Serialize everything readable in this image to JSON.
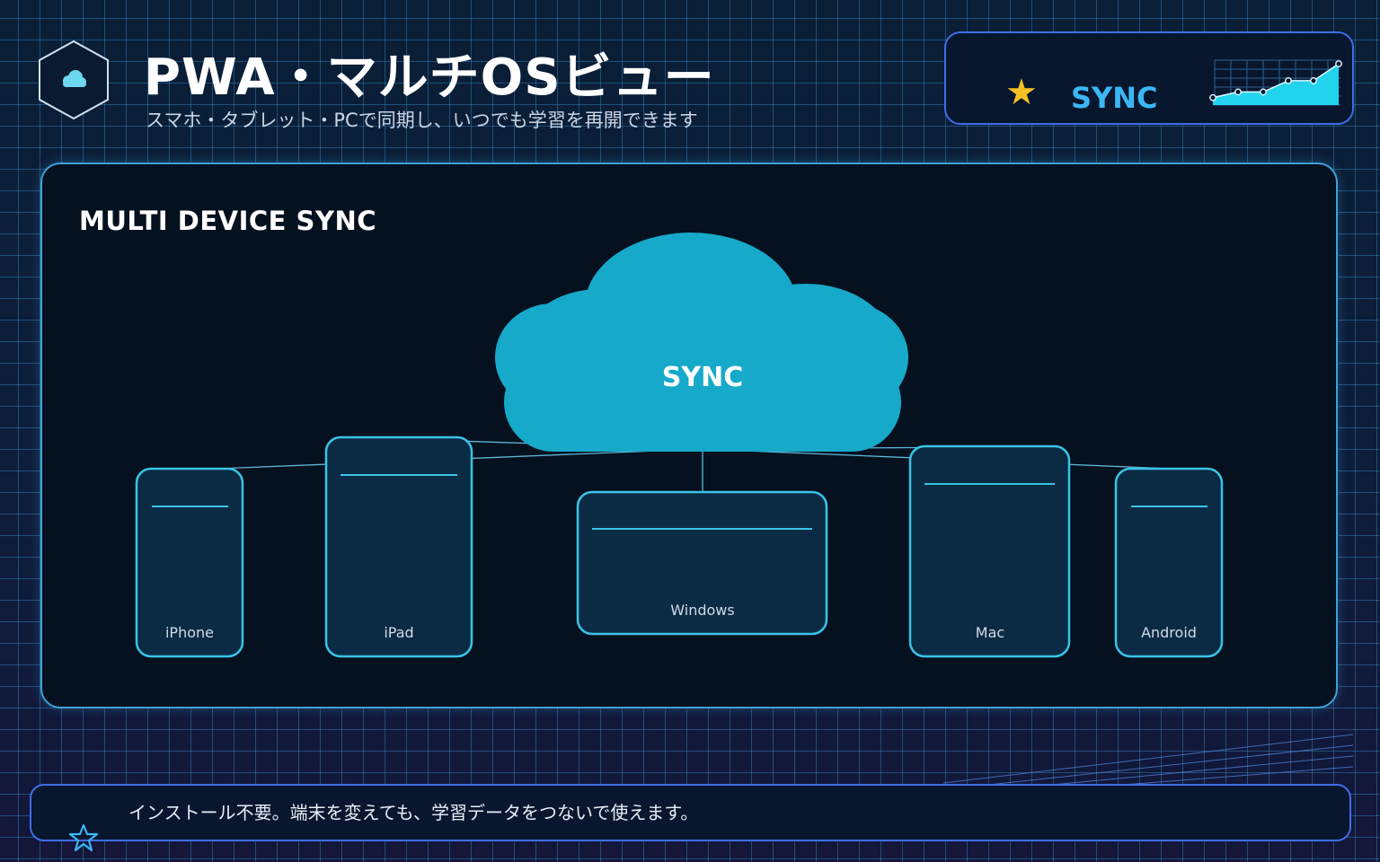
{
  "header": {
    "title": "PWA・マルチOSビュー",
    "subtitle": "スマホ・タブレット・PCで同期し、いつでも学習を再開できます",
    "logo_icon": "cloud-icon"
  },
  "sync_card": {
    "label": "SYNC",
    "star_icon": "star-icon",
    "star_glyph": "★",
    "mini_chart": {
      "type": "line",
      "values": [
        1,
        2,
        2,
        4,
        4,
        7
      ],
      "color": "#22d3ee"
    }
  },
  "panel": {
    "title": "MULTI DEVICE SYNC",
    "cloud_label": "SYNC",
    "devices": [
      {
        "label": "iPhone"
      },
      {
        "label": "iPad"
      },
      {
        "label": "Windows"
      },
      {
        "label": "Mac"
      },
      {
        "label": "Android"
      }
    ]
  },
  "footer": {
    "text": "インストール不要。端末を変えても、学習データをつないで使えます。",
    "star_icon": "star-outline-icon"
  },
  "colors": {
    "accent": "#3bb7f5",
    "cloud": "#17a9c9",
    "star": "#f5c023",
    "border": "#3f6ee8",
    "device_border": "#3ac3e6"
  }
}
